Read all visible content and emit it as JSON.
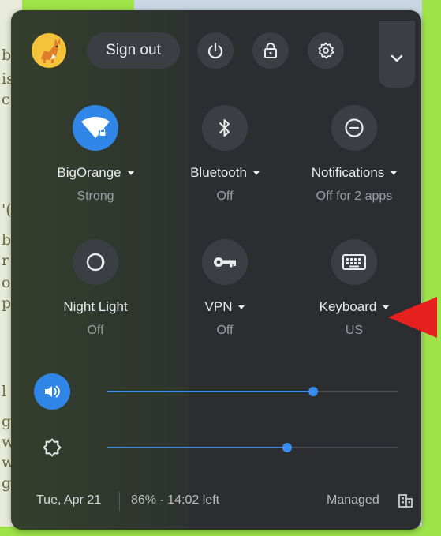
{
  "background": {
    "fragments": [
      "b",
      "is",
      "c",
      "'(",
      "b",
      "r",
      "o",
      "p",
      "l",
      "g",
      "w",
      "w",
      "g"
    ]
  },
  "header": {
    "sign_out_label": "Sign out",
    "icons": [
      "power-icon",
      "lock-icon",
      "settings-icon",
      "chevron-down-icon"
    ]
  },
  "tiles": [
    {
      "label": "BigOrange",
      "sub": "Strong",
      "icon": "wifi-icon",
      "active": true,
      "dropdown": true
    },
    {
      "label": "Bluetooth",
      "sub": "Off",
      "icon": "bluetooth-icon",
      "active": false,
      "dropdown": true
    },
    {
      "label": "Notifications",
      "sub": "Off for 2 apps",
      "icon": "notifications-off-icon",
      "active": false,
      "dropdown": true
    },
    {
      "label": "Night Light",
      "sub": "Off",
      "icon": "night-light-icon",
      "active": false,
      "dropdown": false
    },
    {
      "label": "VPN",
      "sub": "Off",
      "icon": "vpn-key-icon",
      "active": false,
      "dropdown": true
    },
    {
      "label": "Keyboard",
      "sub": "US",
      "icon": "keyboard-icon",
      "active": false,
      "dropdown": true
    }
  ],
  "sliders": {
    "volume": {
      "icon": "volume-icon",
      "value": 0.71
    },
    "brightness": {
      "icon": "brightness-icon",
      "value": 0.62
    }
  },
  "footer": {
    "date": "Tue, Apr 21",
    "battery": "86% - 14:02 left",
    "managed": "Managed",
    "managed_icon": "building-icon"
  },
  "colors": {
    "panel": "#2b2d31",
    "button": "#3b3e43",
    "accent": "#2f86e6",
    "annotation_arrow": "#e6201f"
  }
}
